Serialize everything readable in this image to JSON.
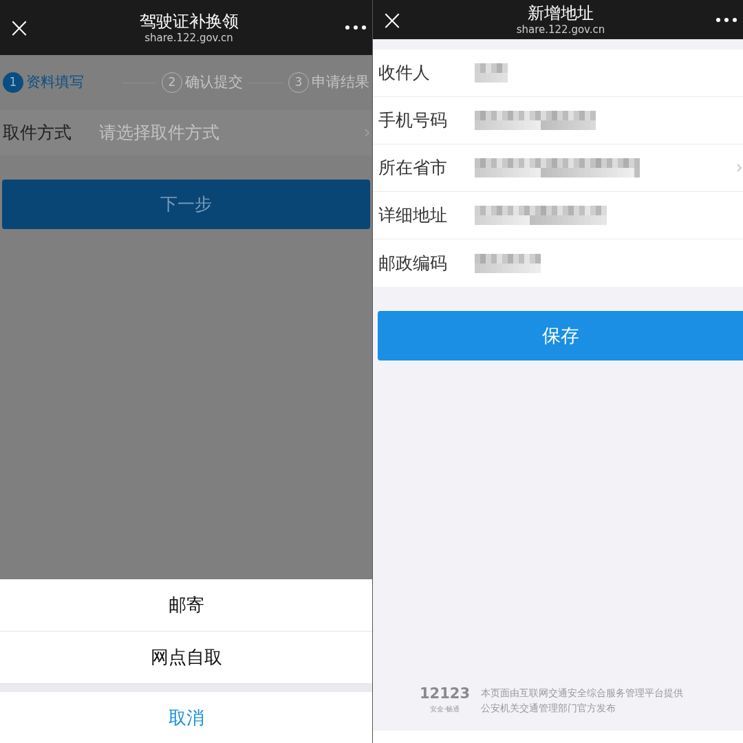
{
  "left_screen": {
    "nav_bar": {
      "close": "×",
      "title": "驾驶证补换领",
      "subtitle": "share.122.gov.cn"
    },
    "steps": [
      {
        "number": "1",
        "label": "资料填写",
        "selected": true
      },
      {
        "number": "2",
        "label": "确认提交",
        "selected": false
      },
      {
        "number": "3",
        "label": "申请结果",
        "selected": false
      }
    ],
    "field": {
      "label": "取件方式",
      "placeholder": "请选择取件方式"
    },
    "next_button": "下一步",
    "action_sheet": {
      "options": [
        "邮寄",
        "网点自取"
      ],
      "cancel": "取消"
    }
  },
  "right_screen": {
    "nav_bar": {
      "close": "×",
      "title": "新增地址",
      "subtitle": "share.122.gov.cn"
    },
    "form_rows": [
      {
        "label": "收件人",
        "has_chevron": false
      },
      {
        "label": "手机号码",
        "has_chevron": false
      },
      {
        "label": "所在省市",
        "has_chevron": true
      },
      {
        "label": "详细地址",
        "has_chevron": false
      },
      {
        "label": "邮政编码",
        "has_chevron": false
      }
    ],
    "save_button": "保存",
    "footer": {
      "logo_number": "12123",
      "logo_slogan": "安全·畅通",
      "lines": [
        "本页面由互联网交通安全综合服务管理平台提供",
        "公安机关交通管理部门官方发布"
      ]
    }
  }
}
